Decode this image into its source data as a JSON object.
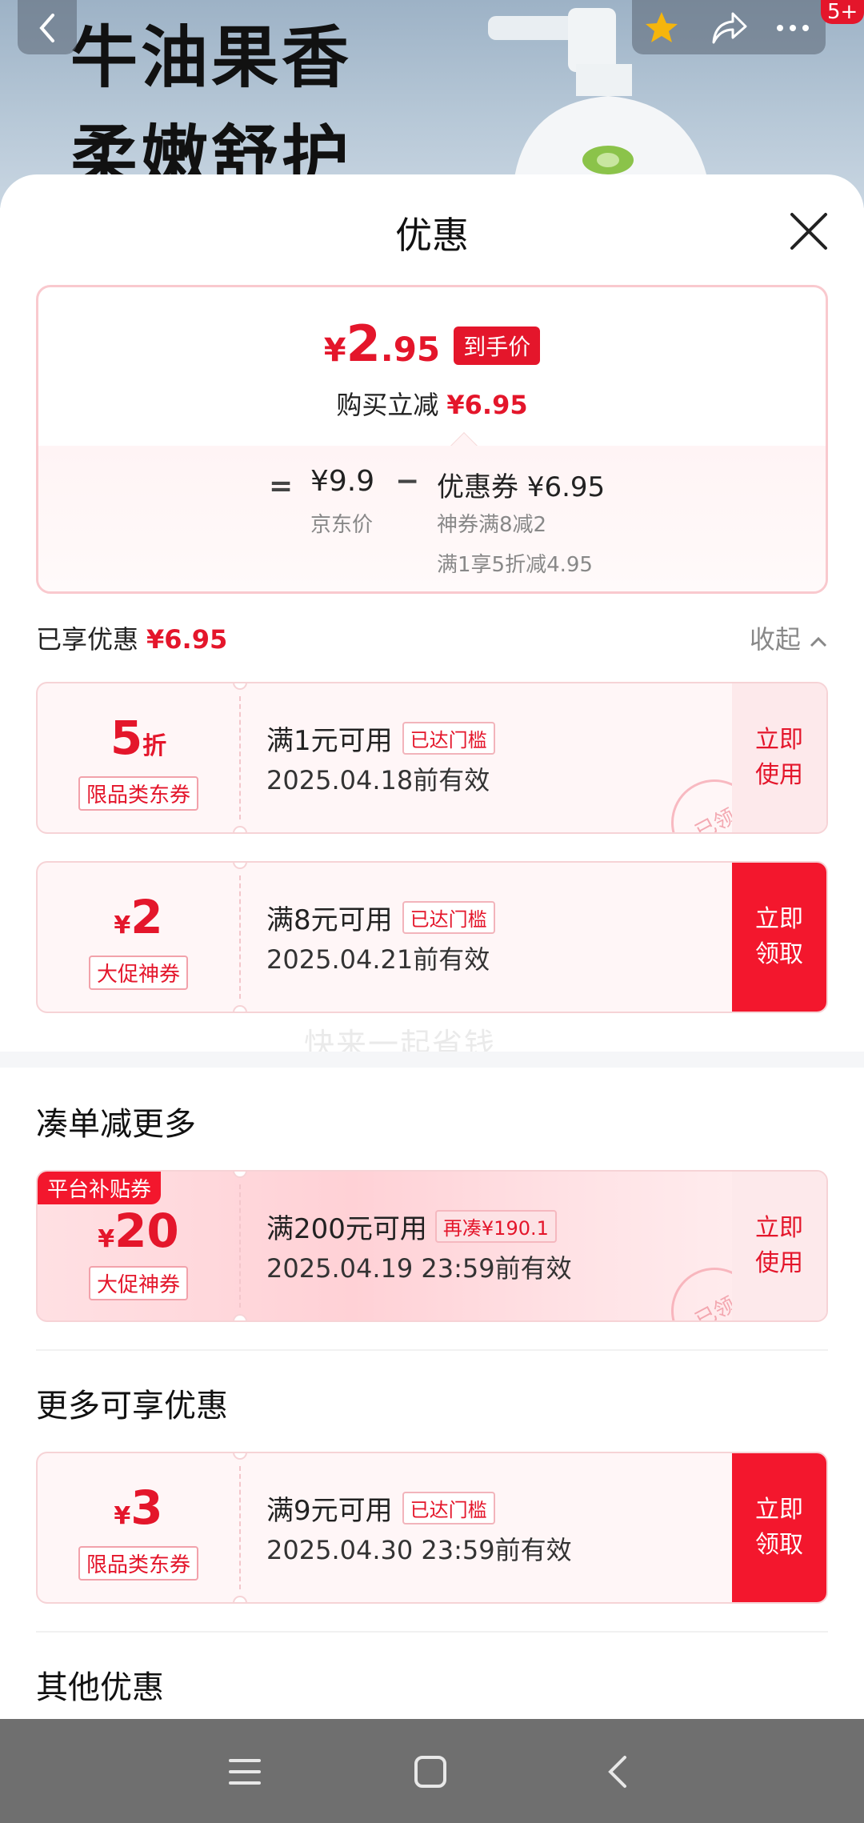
{
  "hero": {
    "line1": "牛油果香",
    "line2": "柔嫩舒护",
    "badge": "5+"
  },
  "sheet": {
    "title": "优惠"
  },
  "summary": {
    "yen": "¥",
    "price_int": "2",
    "price_dec": ".95",
    "price_tag": "到手价",
    "reduce_label": "购买立减",
    "reduce_amount": "¥6.95",
    "eq": "=",
    "jd_price": "¥9.9",
    "jd_price_label": "京东价",
    "minus": "−",
    "coupon_label": "优惠券 ¥6.95",
    "coupon_sub1": "神券满8减2",
    "coupon_sub2": "满1享5折减4.95"
  },
  "enjoyed": {
    "label": "已享优惠",
    "amount": "¥6.95",
    "collapse": "收起"
  },
  "coupons": [
    {
      "amount": "5",
      "unit": "折",
      "tag": "限品类东券",
      "condition": "满1元可用",
      "chip": "已达门槛",
      "date": "2025.04.18前有效",
      "action": "立即\n使用",
      "stamp": "已领"
    },
    {
      "yen": "¥",
      "amount": "2",
      "tag": "大促神券",
      "condition": "满8元可用",
      "chip": "已达门槛",
      "date": "2025.04.21前有效",
      "action": "立即\n领取"
    }
  ],
  "watermark": "快来一起省钱",
  "section_more": {
    "title": "凑单减更多",
    "coupon": {
      "label": "平台补贴券",
      "yen": "¥",
      "amount": "20",
      "tag": "大促神券",
      "condition": "满200元可用",
      "chip": "再凑¥190.1",
      "date": "2025.04.19 23:59前有效",
      "action": "立即\n使用",
      "stamp": "已领"
    }
  },
  "section_enjoy": {
    "title": "更多可享优惠",
    "coupon": {
      "yen": "¥",
      "amount": "3",
      "tag": "限品类东券",
      "condition": "满9元可用",
      "chip": "已达门槛",
      "date": "2025.04.30 23:59前有效",
      "action": "立即\n领取"
    }
  },
  "section_other": {
    "title": "其他优惠"
  },
  "colors": {
    "accent": "#e4162b",
    "coupon_bg": "#fff6f7",
    "navbar": "#6f6f6f"
  },
  "icons": [
    "back-icon",
    "star-icon",
    "share-icon",
    "more-icon",
    "close-icon",
    "chevron-up-icon",
    "menu-icon",
    "home-icon",
    "nav-back-icon"
  ]
}
